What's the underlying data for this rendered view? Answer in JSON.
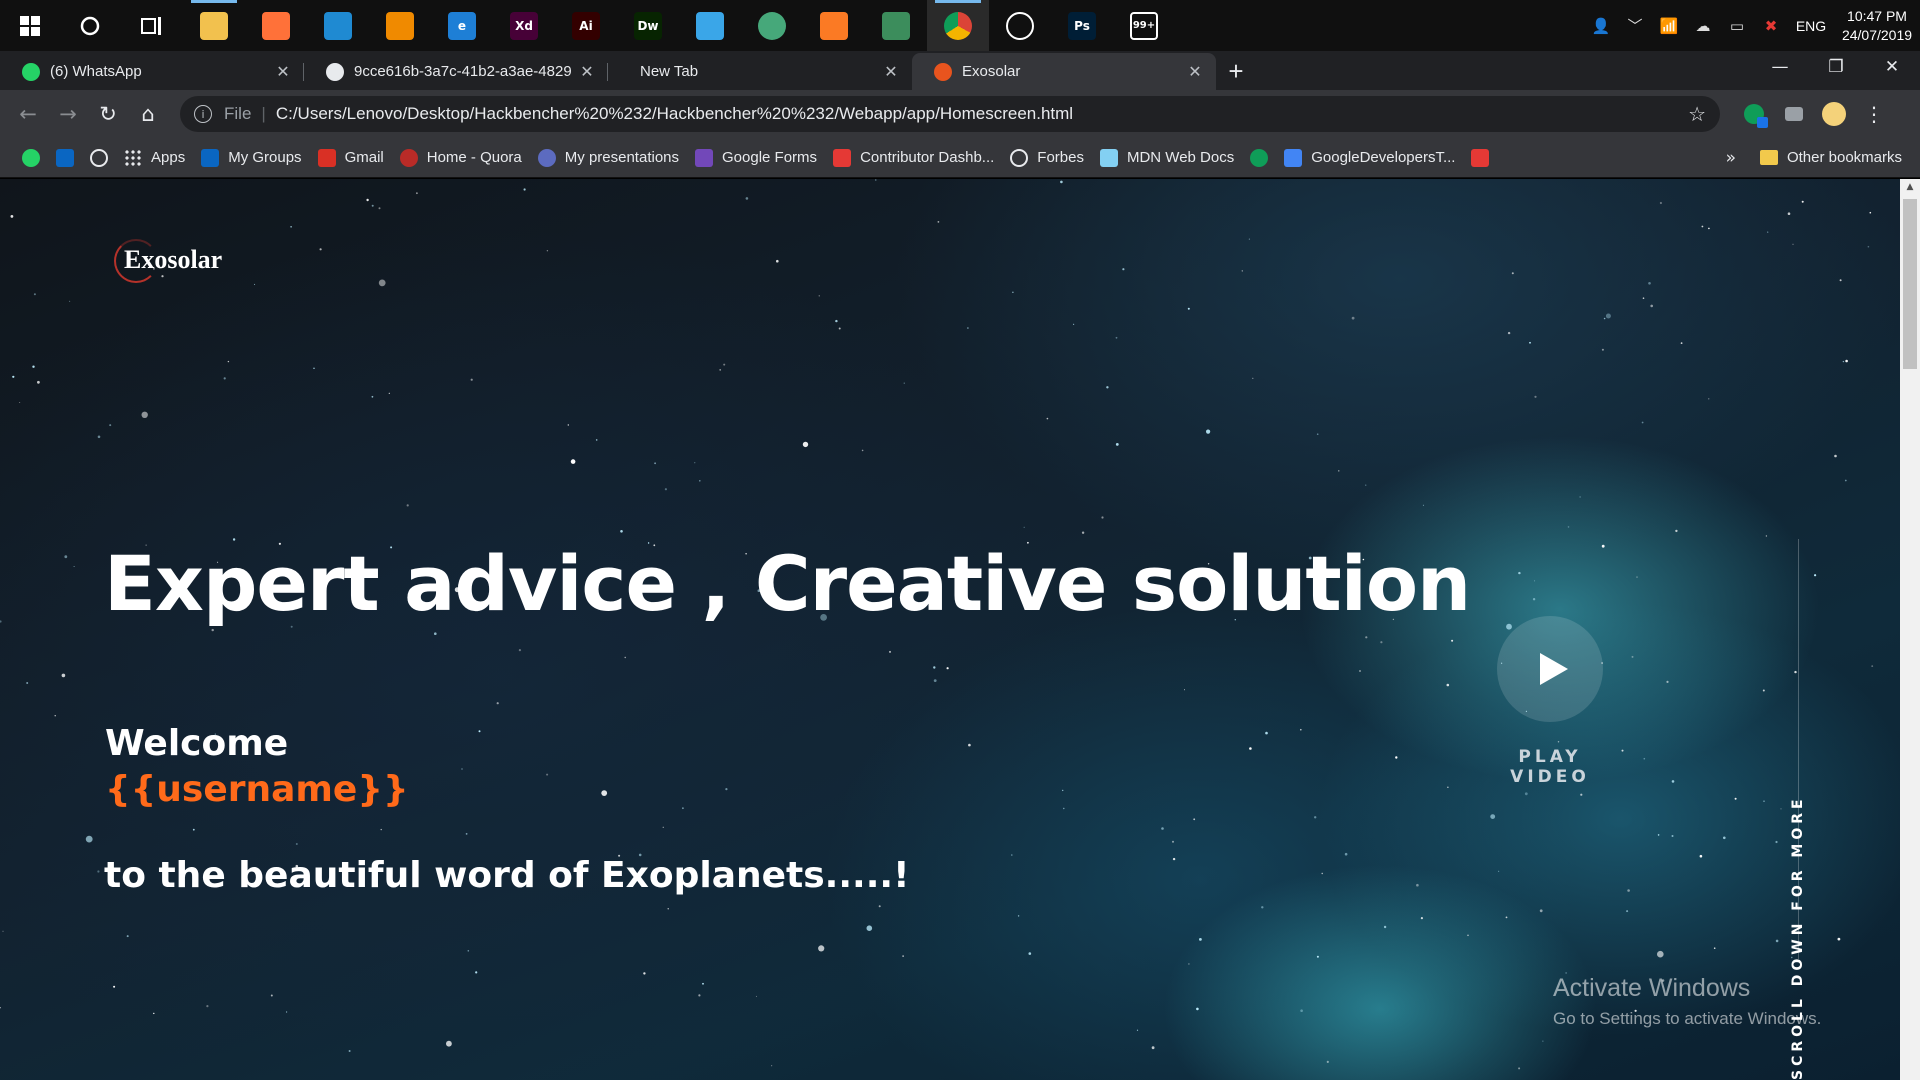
{
  "taskbar": {
    "apps": [
      {
        "name": "file-explorer",
        "label": "",
        "color": "#f2c14e",
        "running": true
      },
      {
        "name": "firefox",
        "label": "",
        "color": "#ff7139",
        "running": false
      },
      {
        "name": "vscode",
        "label": "",
        "color": "#1f8ad2",
        "running": false
      },
      {
        "name": "vlc",
        "label": "",
        "color": "#f08a00",
        "running": false
      },
      {
        "name": "edge",
        "label": "e",
        "color": "#1e7fd6",
        "running": false
      },
      {
        "name": "adobe-xd",
        "label": "Xd",
        "color": "#470137",
        "running": false
      },
      {
        "name": "illustrator",
        "label": "Ai",
        "color": "#330000",
        "running": false
      },
      {
        "name": "dreamweaver",
        "label": "Dw",
        "color": "#072401",
        "running": false
      },
      {
        "name": "generic-app",
        "label": "",
        "color": "#3aa6e8",
        "running": false
      },
      {
        "name": "atom",
        "label": "",
        "color": "#46a87a",
        "running": false
      },
      {
        "name": "xampp",
        "label": "",
        "color": "#fb7a24",
        "running": false
      },
      {
        "name": "pencil-app",
        "label": "",
        "color": "#3c8d5c",
        "running": false
      },
      {
        "name": "chrome",
        "label": "",
        "color": "#4285f4",
        "running": true,
        "active": true
      },
      {
        "name": "groove-music",
        "label": "",
        "color": "#ffffff",
        "running": false
      },
      {
        "name": "photoshop",
        "label": "Ps",
        "color": "#001e36",
        "running": false
      },
      {
        "name": "mail",
        "label": "99+",
        "color": "#ffffff",
        "running": false
      }
    ],
    "tray": {
      "language": "ENG",
      "time": "10:47 PM",
      "date": "24/07/2019"
    }
  },
  "tabs": [
    {
      "title": "(6) WhatsApp",
      "favicon": "whatsapp",
      "color": "#25d366"
    },
    {
      "title": "9cce616b-3a7c-41b2-a3ae-4829",
      "favicon": "globe",
      "color": "#e8eaed"
    },
    {
      "title": "New Tab",
      "favicon": "",
      "color": ""
    },
    {
      "title": "Exosolar",
      "favicon": "exosolar",
      "color": "#e8541e",
      "active": true
    }
  ],
  "omnibox": {
    "scheme": "File",
    "url": "C:/Users/Lenovo/Desktop/Hackbencher%20%232/Hackbencher%20%232/Webapp/app/Homescreen.html"
  },
  "bookmarks": [
    {
      "label": "",
      "icon": "whatsapp",
      "color": "#25d366"
    },
    {
      "label": "",
      "icon": "linkedin",
      "color": "#0a66c2"
    },
    {
      "label": "",
      "icon": "github",
      "color": "#e8eaed"
    },
    {
      "label": "Apps",
      "icon": "apps-grid",
      "color": "#e8eaed"
    },
    {
      "label": "My Groups",
      "icon": "linkedin",
      "color": "#0a66c2"
    },
    {
      "label": "Gmail",
      "icon": "gmail",
      "color": "#d93025"
    },
    {
      "label": "Home - Quora",
      "icon": "quora",
      "color": "#b92b27"
    },
    {
      "label": "My presentations",
      "icon": "presentation",
      "color": "#5c6bc0"
    },
    {
      "label": "Google Forms",
      "icon": "forms",
      "color": "#7248b9"
    },
    {
      "label": "Contributor Dashb...",
      "icon": "contributor",
      "color": "#e53935"
    },
    {
      "label": "Forbes",
      "icon": "globe",
      "color": "#e8eaed"
    },
    {
      "label": "MDN Web Docs",
      "icon": "mdn",
      "color": "#83d0f2"
    },
    {
      "label": "",
      "icon": "hangouts",
      "color": "#0f9d58"
    },
    {
      "label": "GoogleDevelopersT...",
      "icon": "google-developers",
      "color": "#4285f4"
    },
    {
      "label": "",
      "icon": "script",
      "color": "#e53935"
    }
  ],
  "bookmarks_more": "»",
  "other_bookmarks": "Other bookmarks",
  "page": {
    "logo_text": "Exosolar",
    "hero_title": "Expert advice , Creative solution",
    "welcome": "Welcome",
    "username": "{{username}}",
    "tagline": "to the beautiful word of Exoplanets.....!",
    "play_label": "PLAY VIDEO",
    "scroll_label": "SCROLL DOWN FOR MORE",
    "accent_color": "#ff6a1a"
  },
  "watermark": {
    "title": "Activate Windows",
    "subtitle": "Go to Settings to activate Windows."
  }
}
